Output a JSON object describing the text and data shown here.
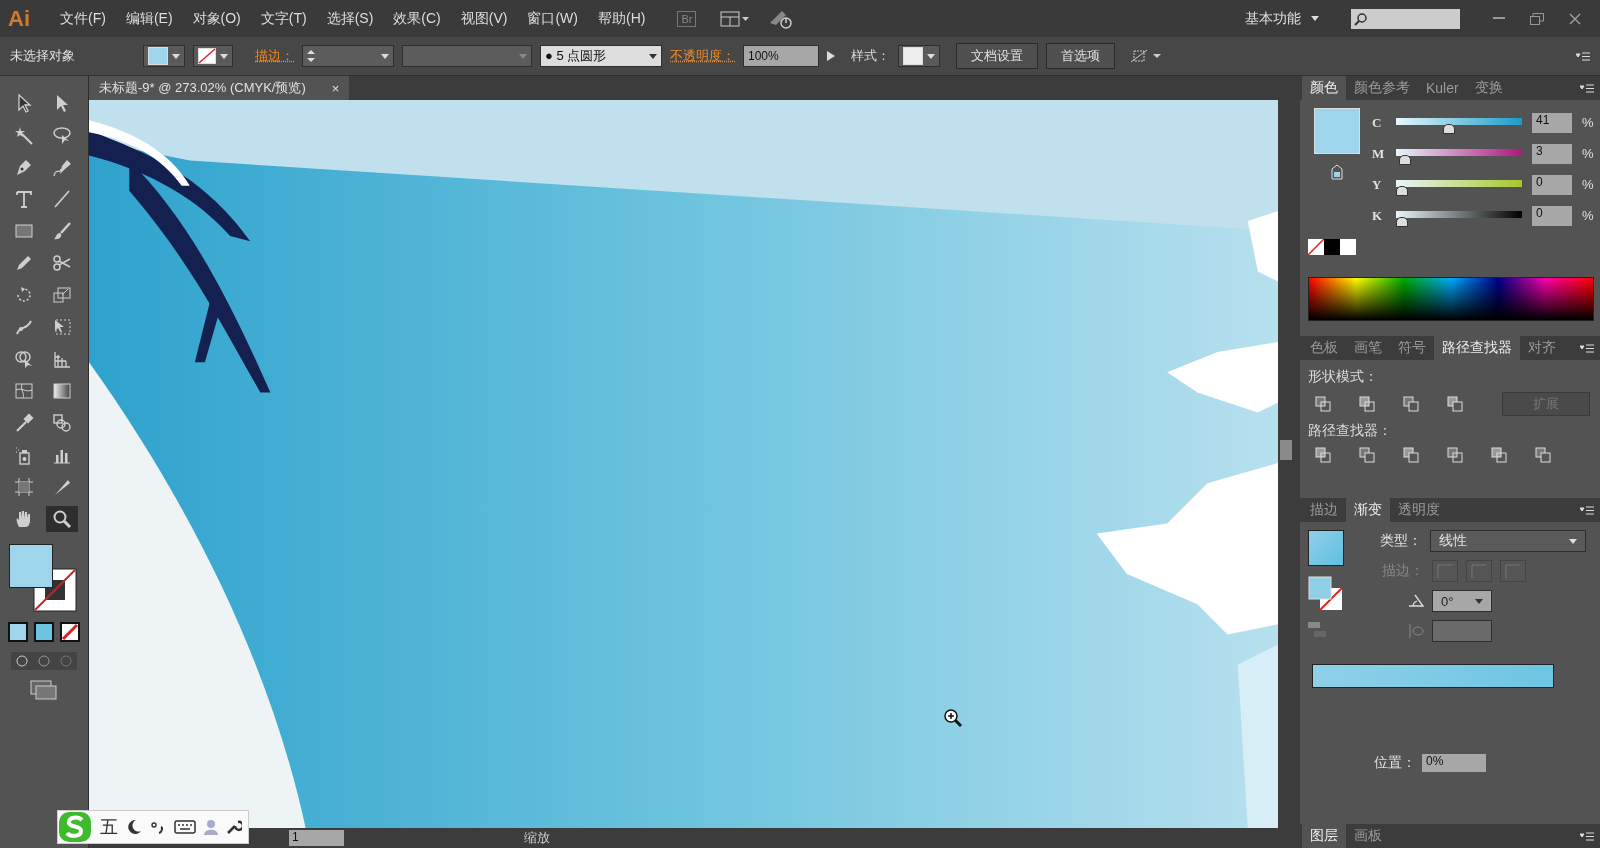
{
  "app": {
    "logo": "Ai",
    "bridge": "Br",
    "workspace": "基本功能"
  },
  "menu": [
    "文件(F)",
    "编辑(E)",
    "对象(O)",
    "文字(T)",
    "选择(S)",
    "效果(C)",
    "视图(V)",
    "窗口(W)",
    "帮助(H)"
  ],
  "control_bar": {
    "selection": "未选择对象",
    "stroke_label": "描边：",
    "brush_bullet": "●",
    "brush": "5 点圆形",
    "opacity_label": "不透明度：",
    "opacity": "100%",
    "style_label": "样式：",
    "document_setup": "文档设置",
    "preferences": "首选项"
  },
  "document_tabs": [
    {
      "title": "未标题-9* @ 273.02% (CMYK/预览)",
      "close": "×",
      "selected": true
    }
  ],
  "tools": [
    {
      "kind": "selection",
      "selected": false
    },
    {
      "kind": "direct-selection",
      "selected": false
    },
    {
      "kind": "magic-wand",
      "selected": false
    },
    {
      "kind": "lasso",
      "selected": false
    },
    {
      "kind": "pen",
      "selected": false
    },
    {
      "kind": "curvature-pen",
      "selected": false
    },
    {
      "kind": "type",
      "selected": false
    },
    {
      "kind": "line",
      "selected": false
    },
    {
      "kind": "rectangle",
      "selected": false
    },
    {
      "kind": "paintbrush",
      "selected": false
    },
    {
      "kind": "pencil",
      "selected": false
    },
    {
      "kind": "scissors",
      "selected": false
    },
    {
      "kind": "rotate",
      "selected": false
    },
    {
      "kind": "scale",
      "selected": false
    },
    {
      "kind": "warp",
      "selected": false
    },
    {
      "kind": "free-transform",
      "selected": false
    },
    {
      "kind": "shape-builder",
      "selected": false
    },
    {
      "kind": "perspective-grid",
      "selected": false
    },
    {
      "kind": "mesh",
      "selected": false
    },
    {
      "kind": "gradient",
      "selected": false
    },
    {
      "kind": "eyedropper",
      "selected": false
    },
    {
      "kind": "blend",
      "selected": false
    },
    {
      "kind": "symbol-sprayer",
      "selected": false
    },
    {
      "kind": "column-graph",
      "selected": false
    },
    {
      "kind": "artboard",
      "selected": false
    },
    {
      "kind": "slice",
      "selected": false
    },
    {
      "kind": "hand",
      "selected": false
    },
    {
      "kind": "zoom",
      "selected": true
    }
  ],
  "color_panel": {
    "tabs": [
      {
        "label": "颜色",
        "selected": true
      },
      {
        "label": "颜色参考",
        "selected": false
      },
      {
        "label": "Kuler",
        "selected": false
      },
      {
        "label": "变换",
        "selected": false
      }
    ],
    "sliders": [
      {
        "name": "C",
        "level": 0.41,
        "value": "41",
        "unit": "%"
      },
      {
        "name": "M",
        "level": 0.03,
        "value": "3",
        "unit": "%"
      },
      {
        "name": "Y",
        "level": 0,
        "value": "0",
        "unit": "%"
      },
      {
        "name": "K",
        "level": 0,
        "value": "0",
        "unit": "%"
      }
    ]
  },
  "pathfinder_panel": {
    "tabs": [
      {
        "label": "色板",
        "selected": false
      },
      {
        "label": "画笔",
        "selected": false
      },
      {
        "label": "符号",
        "selected": false
      },
      {
        "label": "路径查找器",
        "selected": true
      },
      {
        "label": "对齐",
        "selected": false
      }
    ],
    "shape_modes_label": "形状模式：",
    "expand_button": {
      "label": "扩展",
      "disabled": true
    },
    "pathfinders_label": "路径查找器："
  },
  "gradient_panel": {
    "tabs": [
      {
        "label": "描边",
        "selected": false
      },
      {
        "label": "渐变",
        "selected": true
      },
      {
        "label": "透明度",
        "selected": false
      }
    ],
    "type_label": "类型：",
    "type": "线性",
    "stroke_label": "描边：",
    "angle": "0°",
    "location_label": "位置：",
    "location": "0%"
  },
  "bottom_panel": {
    "tabs": [
      {
        "label": "图层",
        "selected": true
      },
      {
        "label": "画板",
        "selected": false
      }
    ]
  },
  "status_bar": {
    "artboard": "1",
    "status": "缩放"
  },
  "ime_toolbar": {
    "mode": "五"
  }
}
